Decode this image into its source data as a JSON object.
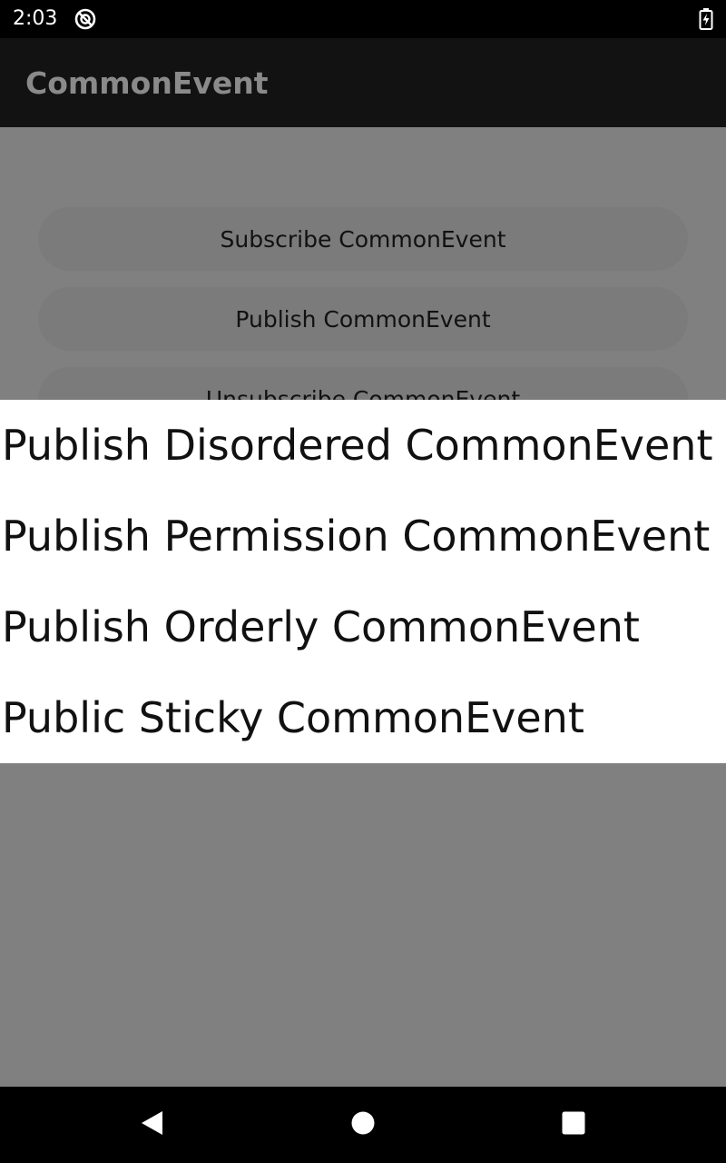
{
  "status_bar": {
    "time": "2:03",
    "left_icon": "do-not-disturb-icon",
    "right_icon": "battery-charging-icon"
  },
  "app_bar": {
    "title": "CommonEvent"
  },
  "buttons": [
    {
      "label": "Subscribe CommonEvent"
    },
    {
      "label": "Publish CommonEvent"
    },
    {
      "label": "Unsubscribe CommonEvent"
    }
  ],
  "menu": {
    "items": [
      {
        "label": "Publish Disordered CommonEvent"
      },
      {
        "label": "Publish Permission CommonEvent"
      },
      {
        "label": "Publish Orderly CommonEvent"
      },
      {
        "label": "Public Sticky CommonEvent"
      }
    ]
  },
  "nav_bar": {
    "back_icon": "back-triangle-icon",
    "home_icon": "home-circle-icon",
    "recents_icon": "recents-square-icon"
  },
  "colors": {
    "scrim": "#808080",
    "menu_background": "#ffffff",
    "system_bars": "#000000"
  }
}
